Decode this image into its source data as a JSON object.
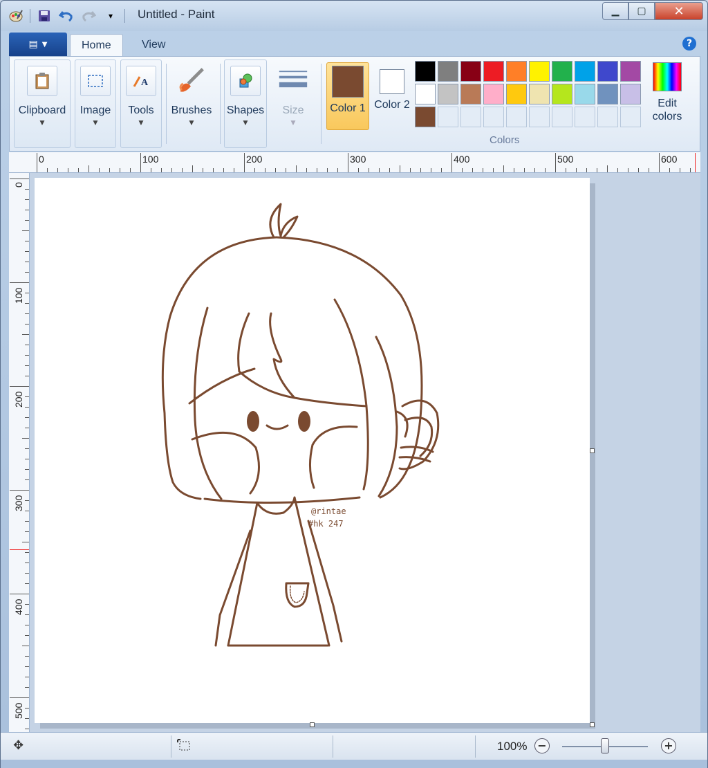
{
  "window": {
    "title": "Untitled - Paint",
    "qat_icons": [
      "paint-app-icon",
      "save-icon",
      "undo-icon",
      "redo-icon",
      "customize-qat-icon"
    ]
  },
  "tabs": [
    {
      "label": "Home",
      "active": true
    },
    {
      "label": "View",
      "active": false
    }
  ],
  "ribbon": {
    "clipboard": "Clipboard",
    "image": "Image",
    "tools": "Tools",
    "brushes": "Brushes",
    "shapes": "Shapes",
    "size": "Size",
    "color1": "Color 1",
    "color2": "Color 2",
    "colors_group": "Colors",
    "edit_colors": "Edit colors",
    "color1_value": "#7a4a30",
    "color2_value": "#ffffff",
    "palette": [
      "#000000",
      "#7f7f7f",
      "#880015",
      "#ed1c24",
      "#ff7f27",
      "#fff200",
      "#22b14c",
      "#00a2e8",
      "#3f48cc",
      "#a349a4",
      "#ffffff",
      "#c3c3c3",
      "#b97a57",
      "#ffaec9",
      "#ffc90e",
      "#efe4b0",
      "#b5e61d",
      "#99d9ea",
      "#7092be",
      "#c8bfe7",
      "#7a4a30",
      "",
      "",
      "",
      "",
      "",
      "",
      "",
      "",
      ""
    ]
  },
  "ruler": {
    "top_labels": [
      "0",
      "100",
      "200",
      "300",
      "400",
      "500",
      "600"
    ],
    "left_labels": [
      "0",
      "100",
      "200",
      "300",
      "400",
      "500"
    ]
  },
  "drawing": {
    "signature_line1": "@rintae",
    "signature_line2": "#hk 247",
    "stroke_color": "#7a4a30"
  },
  "status": {
    "zoom": "100%"
  }
}
